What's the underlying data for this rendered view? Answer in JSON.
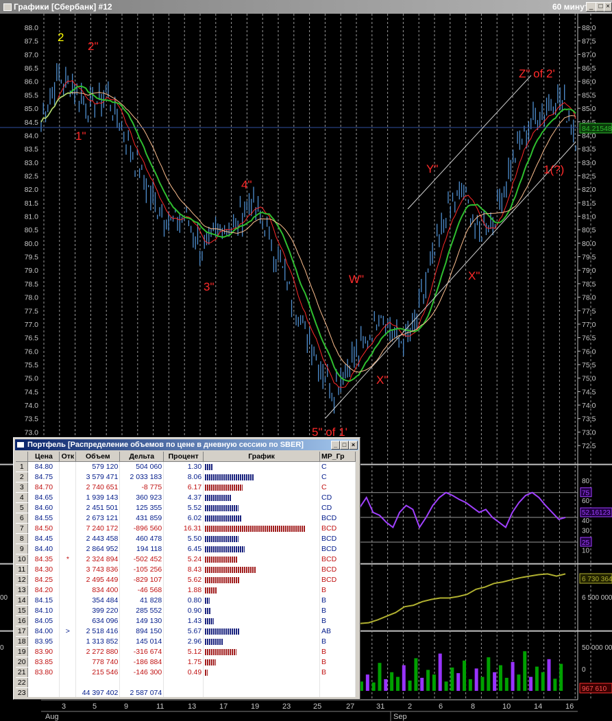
{
  "window": {
    "title": "Графики [Сбербанк] #12",
    "timeframe": "60 минут"
  },
  "colors": {
    "background": "#000000",
    "price_bars": "#4f8fd0",
    "ma_fast": "#ff2a2a",
    "ma_mid": "#2fbf2f",
    "ma_slow": "#ffc090",
    "wave_labels": "#ff2a2a",
    "wave_label_special": "#ffff00",
    "oscillator": "#a040ff",
    "obv": "#b0b030",
    "volume_up": "#00a000",
    "volume_down": "#9933ff",
    "buy_bar": "#1a237e",
    "sell_bar": "#a11e1e"
  },
  "chart_data": {
    "type": "bar",
    "price_axis": {
      "min": 72.5,
      "max": 88.0,
      "ticks": [
        "88.0",
        "87.5",
        "87.0",
        "86.5",
        "86.0",
        "85.5",
        "85.0",
        "84.5",
        "84.0",
        "83.5",
        "83.0",
        "82.5",
        "82.0",
        "81.5",
        "81.0",
        "80.5",
        "80.0",
        "79.5",
        "79.0",
        "78.5",
        "78.0",
        "77.5",
        "77.0",
        "76.5",
        "76.0",
        "75.5",
        "75.0",
        "74.5",
        "74.0",
        "73.5",
        "73.0",
        "72.5"
      ]
    },
    "current_price_label": "84.21548",
    "x_axis": {
      "days": [
        "3",
        "5",
        "9",
        "11",
        "13",
        "17",
        "19",
        "23",
        "25",
        "27",
        "31",
        "2",
        "6",
        "8",
        "10",
        "14",
        "16"
      ],
      "months": [
        "Aug",
        "Sep"
      ]
    },
    "price_path": [
      84.5,
      86.2,
      85.8,
      85.0,
      85.6,
      84.2,
      82.8,
      81.5,
      80.8,
      81.0,
      79.6,
      80.6,
      80.7,
      81.6,
      80.4,
      78.8,
      77.2,
      75.8,
      74.5,
      75.6,
      76.2,
      77.6,
      76.3,
      76.8,
      79.0,
      81.0,
      82.0,
      80.3,
      81.0,
      83.0,
      84.2,
      84.9,
      85.5,
      84.0
    ],
    "wave_labels": [
      "2",
      "2\"",
      "1\"",
      "3\"",
      "4\"",
      "5\" of 1'",
      "W\"",
      "X\"",
      "Y\"",
      "X\"",
      "Z\" of 2'",
      "1(?)"
    ],
    "oscillator": {
      "levels": [
        "75",
        "25"
      ],
      "current": "52.16123",
      "scale": [
        "80",
        "70",
        "60",
        "50",
        "40",
        "30",
        "20",
        "10"
      ],
      "values": [
        60,
        70,
        55,
        52,
        45,
        40,
        55,
        62,
        58,
        40,
        50,
        62,
        70,
        75,
        72,
        68,
        65,
        60,
        55,
        58,
        50,
        45,
        40,
        55,
        65,
        72,
        75,
        70,
        62,
        55,
        48,
        50
      ]
    },
    "obv": {
      "current": "6 730 364",
      "scale": [
        "6 500 000"
      ],
      "left_label": "00",
      "values": [
        6.05,
        6.06,
        6.1,
        6.15,
        6.2,
        6.28,
        6.3,
        6.35,
        6.38,
        6.4,
        6.4,
        6.42,
        6.45,
        6.52,
        6.55,
        6.6,
        6.62,
        6.65,
        6.68,
        6.7,
        6.72,
        6.73,
        6.7,
        6.73
      ]
    },
    "volume": {
      "current": "967 610",
      "scale": [
        "50 000 000",
        "0"
      ],
      "left_label": "0",
      "values": [
        20,
        35,
        18,
        60,
        25,
        40,
        30,
        55,
        22,
        70,
        28,
        45,
        35,
        80,
        20,
        50,
        38,
        65,
        25,
        48,
        30,
        72,
        40,
        55,
        28,
        62,
        35,
        85,
        30,
        52,
        40,
        68,
        26,
        58
      ]
    }
  },
  "portfolio": {
    "title": "Портфель [Распределение объемов по цене в дневную сессию по SBER]",
    "columns": [
      "Цена",
      "Отк",
      "Объем",
      "Дельта",
      "Процент",
      "График",
      "MP_Гр"
    ],
    "rows": [
      {
        "n": "1",
        "price": "84.80",
        "otk": "",
        "vol": "579 120",
        "delta": "504 060",
        "pct": "1.30",
        "mp": "C",
        "side": "buy",
        "bar": 1.3
      },
      {
        "n": "2",
        "price": "84.75",
        "otk": "",
        "vol": "3 579 471",
        "delta": "2 033 183",
        "pct": "8.06",
        "mp": "C",
        "side": "buy",
        "bar": 8.06
      },
      {
        "n": "3",
        "price": "84.70",
        "otk": "",
        "vol": "2 740 651",
        "delta": "-8 775",
        "pct": "6.17",
        "mp": "C",
        "side": "sell",
        "bar": 6.17
      },
      {
        "n": "4",
        "price": "84.65",
        "otk": "",
        "vol": "1 939 143",
        "delta": "360 923",
        "pct": "4.37",
        "mp": "CD",
        "side": "buy",
        "bar": 4.37
      },
      {
        "n": "5",
        "price": "84.60",
        "otk": "",
        "vol": "2 451 501",
        "delta": "125 355",
        "pct": "5.52",
        "mp": "CD",
        "side": "buy",
        "bar": 5.52
      },
      {
        "n": "6",
        "price": "84.55",
        "otk": "",
        "vol": "2 673 121",
        "delta": "431 859",
        "pct": "6.02",
        "mp": "BCD",
        "side": "buy",
        "bar": 6.02
      },
      {
        "n": "7",
        "price": "84.50",
        "otk": "",
        "vol": "7 240 172",
        "delta": "-896 560",
        "pct": "16.31",
        "mp": "BCD",
        "side": "sell",
        "bar": 16.31
      },
      {
        "n": "8",
        "price": "84.45",
        "otk": "",
        "vol": "2 443 458",
        "delta": "460 478",
        "pct": "5.50",
        "mp": "BCD",
        "side": "buy",
        "bar": 5.5
      },
      {
        "n": "9",
        "price": "84.40",
        "otk": "",
        "vol": "2 864 952",
        "delta": "194 118",
        "pct": "6.45",
        "mp": "BCD",
        "side": "buy",
        "bar": 6.45
      },
      {
        "n": "10",
        "price": "84.35",
        "otk": "*",
        "vol": "2 324 894",
        "delta": "-502 452",
        "pct": "5.24",
        "mp": "BCD",
        "side": "sell",
        "bar": 5.24
      },
      {
        "n": "11",
        "price": "84.30",
        "otk": "",
        "vol": "3 743 836",
        "delta": "-105 256",
        "pct": "8.43",
        "mp": "BCD",
        "side": "sell",
        "bar": 8.43
      },
      {
        "n": "12",
        "price": "84.25",
        "otk": "",
        "vol": "2 495 449",
        "delta": "-829 107",
        "pct": "5.62",
        "mp": "BCD",
        "side": "sell",
        "bar": 5.62
      },
      {
        "n": "13",
        "price": "84.20",
        "otk": "",
        "vol": "834 400",
        "delta": "-46 568",
        "pct": "1.88",
        "mp": "B",
        "side": "sell",
        "bar": 1.88
      },
      {
        "n": "14",
        "price": "84.15",
        "otk": "",
        "vol": "354 484",
        "delta": "41 828",
        "pct": "0.80",
        "mp": "B",
        "side": "buy",
        "bar": 0.8
      },
      {
        "n": "15",
        "price": "84.10",
        "otk": "",
        "vol": "399 220",
        "delta": "285 552",
        "pct": "0.90",
        "mp": "B",
        "side": "buy",
        "bar": 0.9
      },
      {
        "n": "16",
        "price": "84.05",
        "otk": "",
        "vol": "634 096",
        "delta": "149 130",
        "pct": "1.43",
        "mp": "B",
        "side": "buy",
        "bar": 1.43
      },
      {
        "n": "17",
        "price": "84.00",
        "otk": ">",
        "vol": "2 518 416",
        "delta": "894 150",
        "pct": "5.67",
        "mp": "AB",
        "side": "buy",
        "bar": 5.67
      },
      {
        "n": "18",
        "price": "83.95",
        "otk": "",
        "vol": "1 313 852",
        "delta": "145 014",
        "pct": "2.96",
        "mp": "B",
        "side": "buy",
        "bar": 2.96
      },
      {
        "n": "19",
        "price": "83.90",
        "otk": "",
        "vol": "2 272 880",
        "delta": "-316 674",
        "pct": "5.12",
        "mp": "B",
        "side": "sell",
        "bar": 5.12
      },
      {
        "n": "20",
        "price": "83.85",
        "otk": "",
        "vol": "778 740",
        "delta": "-186 884",
        "pct": "1.75",
        "mp": "B",
        "side": "sell",
        "bar": 1.75
      },
      {
        "n": "21",
        "price": "83.80",
        "otk": "",
        "vol": "215 546",
        "delta": "-146 300",
        "pct": "0.49",
        "mp": "B",
        "side": "sell",
        "bar": 0.49
      },
      {
        "n": "22",
        "price": "",
        "otk": "",
        "vol": "",
        "delta": "",
        "pct": "",
        "mp": "",
        "side": "",
        "bar": 0
      },
      {
        "n": "23",
        "price": "",
        "otk": "",
        "vol": "44 397 402",
        "delta": "2 587 074",
        "pct": "",
        "mp": "",
        "side": "",
        "bar": 0
      }
    ]
  }
}
